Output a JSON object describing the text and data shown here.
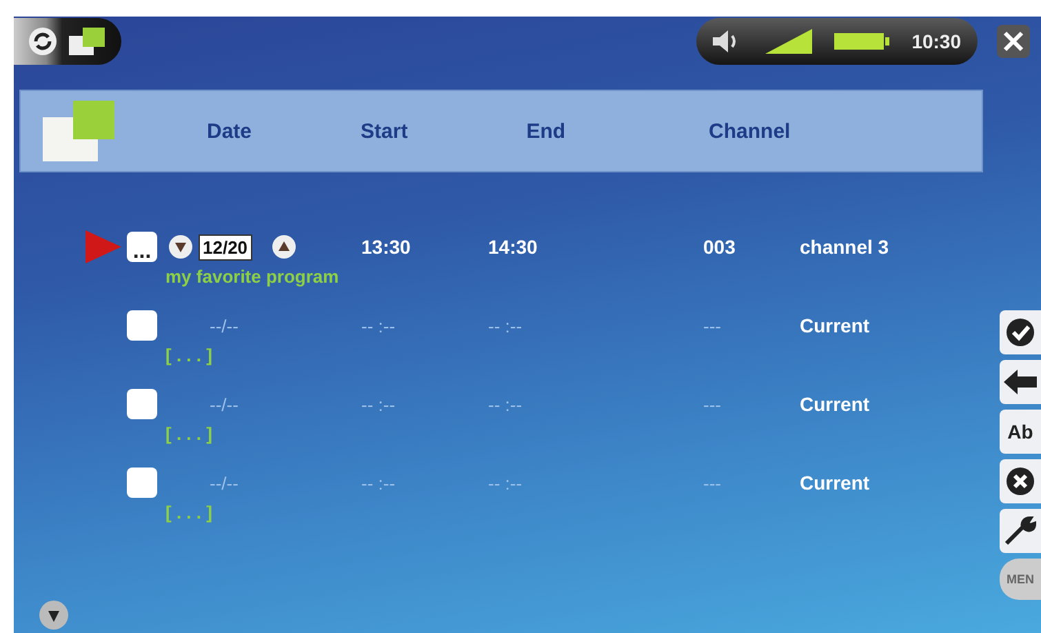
{
  "status_bar": {
    "time": "10:30"
  },
  "table": {
    "columns": [
      "Date",
      "Start",
      "End",
      "Channel"
    ],
    "rows": [
      {
        "selected": true,
        "more": "...",
        "date": "12/20",
        "start": "13:30",
        "end": "14:30",
        "number": "003",
        "channel": "channel 3",
        "name": "my favorite program"
      },
      {
        "selected": false,
        "date": "--/--",
        "start": "-- :--",
        "end": "-- :--",
        "number": "---",
        "channel": "Current",
        "name": "[ . . . ]"
      },
      {
        "selected": false,
        "date": "--/--",
        "start": "-- :--",
        "end": "-- :--",
        "number": "---",
        "channel": "Current",
        "name": "[ . . . ]"
      },
      {
        "selected": false,
        "date": "--/--",
        "start": "-- :--",
        "end": "-- :--",
        "number": "---",
        "channel": "Current",
        "name": "[ . . . ]"
      }
    ]
  },
  "side_toolbar": [
    {
      "kind": "check"
    },
    {
      "kind": "back"
    },
    {
      "kind": "rename",
      "label": "Ab"
    },
    {
      "kind": "delete"
    },
    {
      "kind": "settings"
    },
    {
      "kind": "menu",
      "label": "MEN"
    }
  ]
}
